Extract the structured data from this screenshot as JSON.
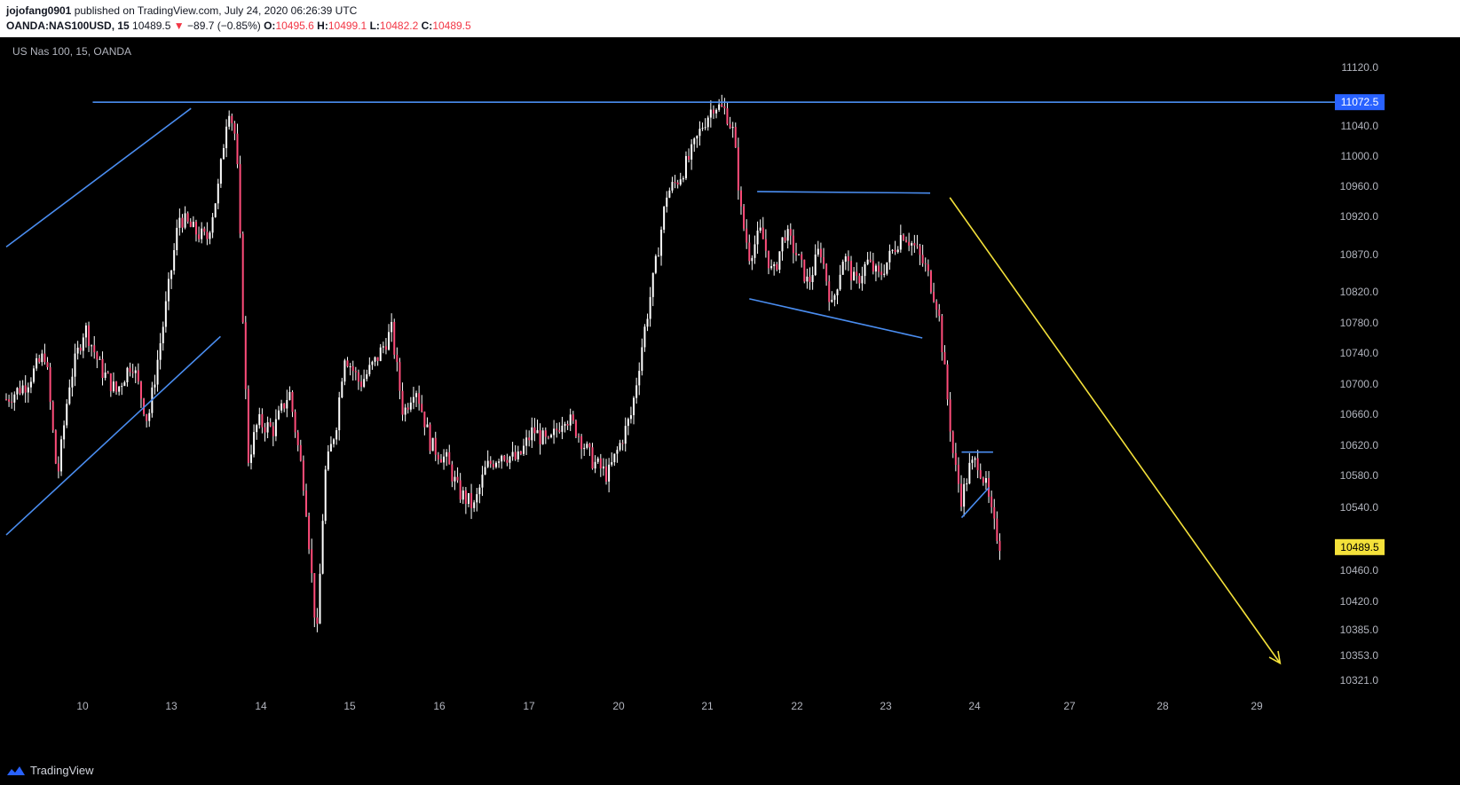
{
  "header": {
    "author": "jojofang0901",
    "published_text": "published on TradingView.com, July 24, 2020 06:26:39 UTC",
    "symbol": "OANDA:NAS100USD, 15",
    "last": "10489.5",
    "change": "−89.7 (−0.85%)",
    "o_label": "O:",
    "o_value": "10495.6",
    "h_label": "H:",
    "h_value": "10499.1",
    "l_label": "L:",
    "l_value": "10482.2",
    "c_label": "C:",
    "c_value": "10489.5"
  },
  "footer": {
    "brand": "TradingView"
  },
  "colors": {
    "bg": "#000000",
    "candle": "#ff4d7a",
    "wick": "#ffffff",
    "trendline": "#4a8df0",
    "arrow": "#f4e13a",
    "axis_text": "#b2b5be",
    "resistance_tag": "#2962ff",
    "price_tag": "#f4e13a"
  },
  "chart_data": {
    "type": "candlestick",
    "title": "US Nas 100, 15, OANDA",
    "y_ticks": [
      11120.0,
      11040.0,
      11000.0,
      10960.0,
      10920.0,
      10870.0,
      10820.0,
      10780.0,
      10740.0,
      10700.0,
      10660.0,
      10620.0,
      10580.0,
      10540.0,
      10460.0,
      10420.0,
      10385.0,
      10353.0,
      10321.0
    ],
    "y_tick_labels": [
      "11120.0",
      "11040.0",
      "11000.0",
      "10960.0",
      "10920.0",
      "10870.0",
      "10820.0",
      "10780.0",
      "10740.0",
      "10700.0",
      "10660.0",
      "10620.0",
      "10580.0",
      "10540.0",
      "10460.0",
      "10420.0",
      "10385.0",
      "10353.0",
      "10321.0"
    ],
    "x_ticks": [
      "10",
      "13",
      "14",
      "15",
      "16",
      "17",
      "20",
      "21",
      "22",
      "23",
      "24",
      "27",
      "28",
      "29"
    ],
    "resistance_label": "11072.5",
    "resistance": 11072.5,
    "last_price_label": "10489.5",
    "last_price": 10489.5,
    "price_path": [
      {
        "x": 0.0,
        "y": 10680
      },
      {
        "x": 0.5,
        "y": 10700
      },
      {
        "x": 1.0,
        "y": 10740
      },
      {
        "x": 1.3,
        "y": 10575
      },
      {
        "x": 1.6,
        "y": 10700
      },
      {
        "x": 2.0,
        "y": 10775
      },
      {
        "x": 2.4,
        "y": 10720
      },
      {
        "x": 2.8,
        "y": 10690
      },
      {
        "x": 3.2,
        "y": 10730
      },
      {
        "x": 3.6,
        "y": 10650
      },
      {
        "x": 4.0,
        "y": 10780
      },
      {
        "x": 4.4,
        "y": 10920
      },
      {
        "x": 4.8,
        "y": 10900
      },
      {
        "x": 5.1,
        "y": 10890
      },
      {
        "x": 5.4,
        "y": 10960
      },
      {
        "x": 5.65,
        "y": 11070
      },
      {
        "x": 5.85,
        "y": 11020
      },
      {
        "x": 6.0,
        "y": 10820
      },
      {
        "x": 6.15,
        "y": 10600
      },
      {
        "x": 6.4,
        "y": 10650
      },
      {
        "x": 6.8,
        "y": 10640
      },
      {
        "x": 7.2,
        "y": 10690
      },
      {
        "x": 7.6,
        "y": 10560
      },
      {
        "x": 7.9,
        "y": 10370
      },
      {
        "x": 8.1,
        "y": 10580
      },
      {
        "x": 8.4,
        "y": 10650
      },
      {
        "x": 8.6,
        "y": 10740
      },
      {
        "x": 9.0,
        "y": 10700
      },
      {
        "x": 9.4,
        "y": 10730
      },
      {
        "x": 9.8,
        "y": 10770
      },
      {
        "x": 10.1,
        "y": 10660
      },
      {
        "x": 10.4,
        "y": 10700
      },
      {
        "x": 10.8,
        "y": 10620
      },
      {
        "x": 11.2,
        "y": 10600
      },
      {
        "x": 11.5,
        "y": 10560
      },
      {
        "x": 11.9,
        "y": 10540
      },
      {
        "x": 12.2,
        "y": 10590
      },
      {
        "x": 12.6,
        "y": 10610
      },
      {
        "x": 13.0,
        "y": 10600
      },
      {
        "x": 13.4,
        "y": 10640
      },
      {
        "x": 13.8,
        "y": 10620
      },
      {
        "x": 14.2,
        "y": 10660
      },
      {
        "x": 14.5,
        "y": 10640
      },
      {
        "x": 14.9,
        "y": 10600
      },
      {
        "x": 15.3,
        "y": 10580
      },
      {
        "x": 15.6,
        "y": 10620
      },
      {
        "x": 15.9,
        "y": 10660
      },
      {
        "x": 16.2,
        "y": 10760
      },
      {
        "x": 16.5,
        "y": 10850
      },
      {
        "x": 16.8,
        "y": 10950
      },
      {
        "x": 17.1,
        "y": 10970
      },
      {
        "x": 17.4,
        "y": 11000
      },
      {
        "x": 17.7,
        "y": 11040
      },
      {
        "x": 18.0,
        "y": 11070
      },
      {
        "x": 18.3,
        "y": 11060
      },
      {
        "x": 18.5,
        "y": 11030
      },
      {
        "x": 18.7,
        "y": 10920
      },
      {
        "x": 18.9,
        "y": 10870
      },
      {
        "x": 19.2,
        "y": 10900
      },
      {
        "x": 19.5,
        "y": 10840
      },
      {
        "x": 19.8,
        "y": 10900
      },
      {
        "x": 20.1,
        "y": 10870
      },
      {
        "x": 20.4,
        "y": 10830
      },
      {
        "x": 20.7,
        "y": 10880
      },
      {
        "x": 21.0,
        "y": 10800
      },
      {
        "x": 21.3,
        "y": 10870
      },
      {
        "x": 21.6,
        "y": 10830
      },
      {
        "x": 21.9,
        "y": 10860
      },
      {
        "x": 22.2,
        "y": 10840
      },
      {
        "x": 22.5,
        "y": 10870
      },
      {
        "x": 22.8,
        "y": 10900
      },
      {
        "x": 23.1,
        "y": 10880
      },
      {
        "x": 23.4,
        "y": 10850
      },
      {
        "x": 23.7,
        "y": 10800
      },
      {
        "x": 23.9,
        "y": 10700
      },
      {
        "x": 24.1,
        "y": 10600
      },
      {
        "x": 24.3,
        "y": 10550
      },
      {
        "x": 24.5,
        "y": 10590
      },
      {
        "x": 24.7,
        "y": 10600
      },
      {
        "x": 24.9,
        "y": 10570
      },
      {
        "x": 25.1,
        "y": 10520
      },
      {
        "x": 25.3,
        "y": 10489.5
      }
    ],
    "drawings": [
      {
        "type": "line",
        "x1": 0.0,
        "y1": 10880,
        "x2": 4.7,
        "y2": 11064
      },
      {
        "type": "line",
        "x1": 0.0,
        "y1": 10505,
        "x2": 5.45,
        "y2": 10762
      },
      {
        "type": "line",
        "x1": 2.2,
        "y1": 11072.5,
        "x2": 34.0,
        "y2": 11072.5
      },
      {
        "type": "line",
        "x1": 19.1,
        "y1": 10953,
        "x2": 23.5,
        "y2": 10951
      },
      {
        "type": "line",
        "x1": 18.9,
        "y1": 10811,
        "x2": 23.3,
        "y2": 10760
      },
      {
        "type": "line",
        "x1": 24.3,
        "y1": 10611,
        "x2": 25.1,
        "y2": 10611
      },
      {
        "type": "line",
        "x1": 24.3,
        "y1": 10527,
        "x2": 25.0,
        "y2": 10565
      },
      {
        "type": "arrow",
        "x1": 24.0,
        "y1": 10945,
        "x2": 32.4,
        "y2": 10343
      }
    ]
  }
}
